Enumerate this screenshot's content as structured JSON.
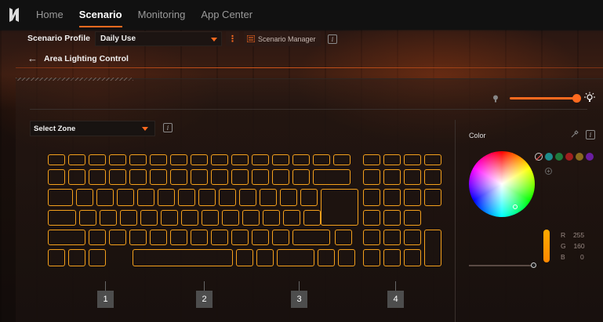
{
  "nav": {
    "logo": "N-logo-icon",
    "tabs": [
      {
        "label": "Home",
        "active": false
      },
      {
        "label": "Scenario",
        "active": true
      },
      {
        "label": "Monitoring",
        "active": false
      },
      {
        "label": "App Center",
        "active": false
      }
    ]
  },
  "profile": {
    "label": "Scenario Profile",
    "value": "Daily Use",
    "more": "⋮",
    "manager_label": "Scenario Manager"
  },
  "page": {
    "back_icon": "arrow-left-icon",
    "title": "Area Lighting Control"
  },
  "brightness": {
    "level": 1.0
  },
  "zone": {
    "placeholder": "Select Zone",
    "labels": [
      "1",
      "2",
      "3",
      "4"
    ]
  },
  "color": {
    "label": "Color",
    "swatches": [
      "none",
      "#1e8c8c",
      "#1e7a3c",
      "#a01e1e",
      "#8a6a1e",
      "#6a1ea0"
    ],
    "r_label": "R",
    "r_value": "255",
    "g_label": "G",
    "g_value": "160",
    "b_label": "B",
    "b_value": "0",
    "accent": "#ff6a1f",
    "key_outline": "#f4a01c"
  }
}
